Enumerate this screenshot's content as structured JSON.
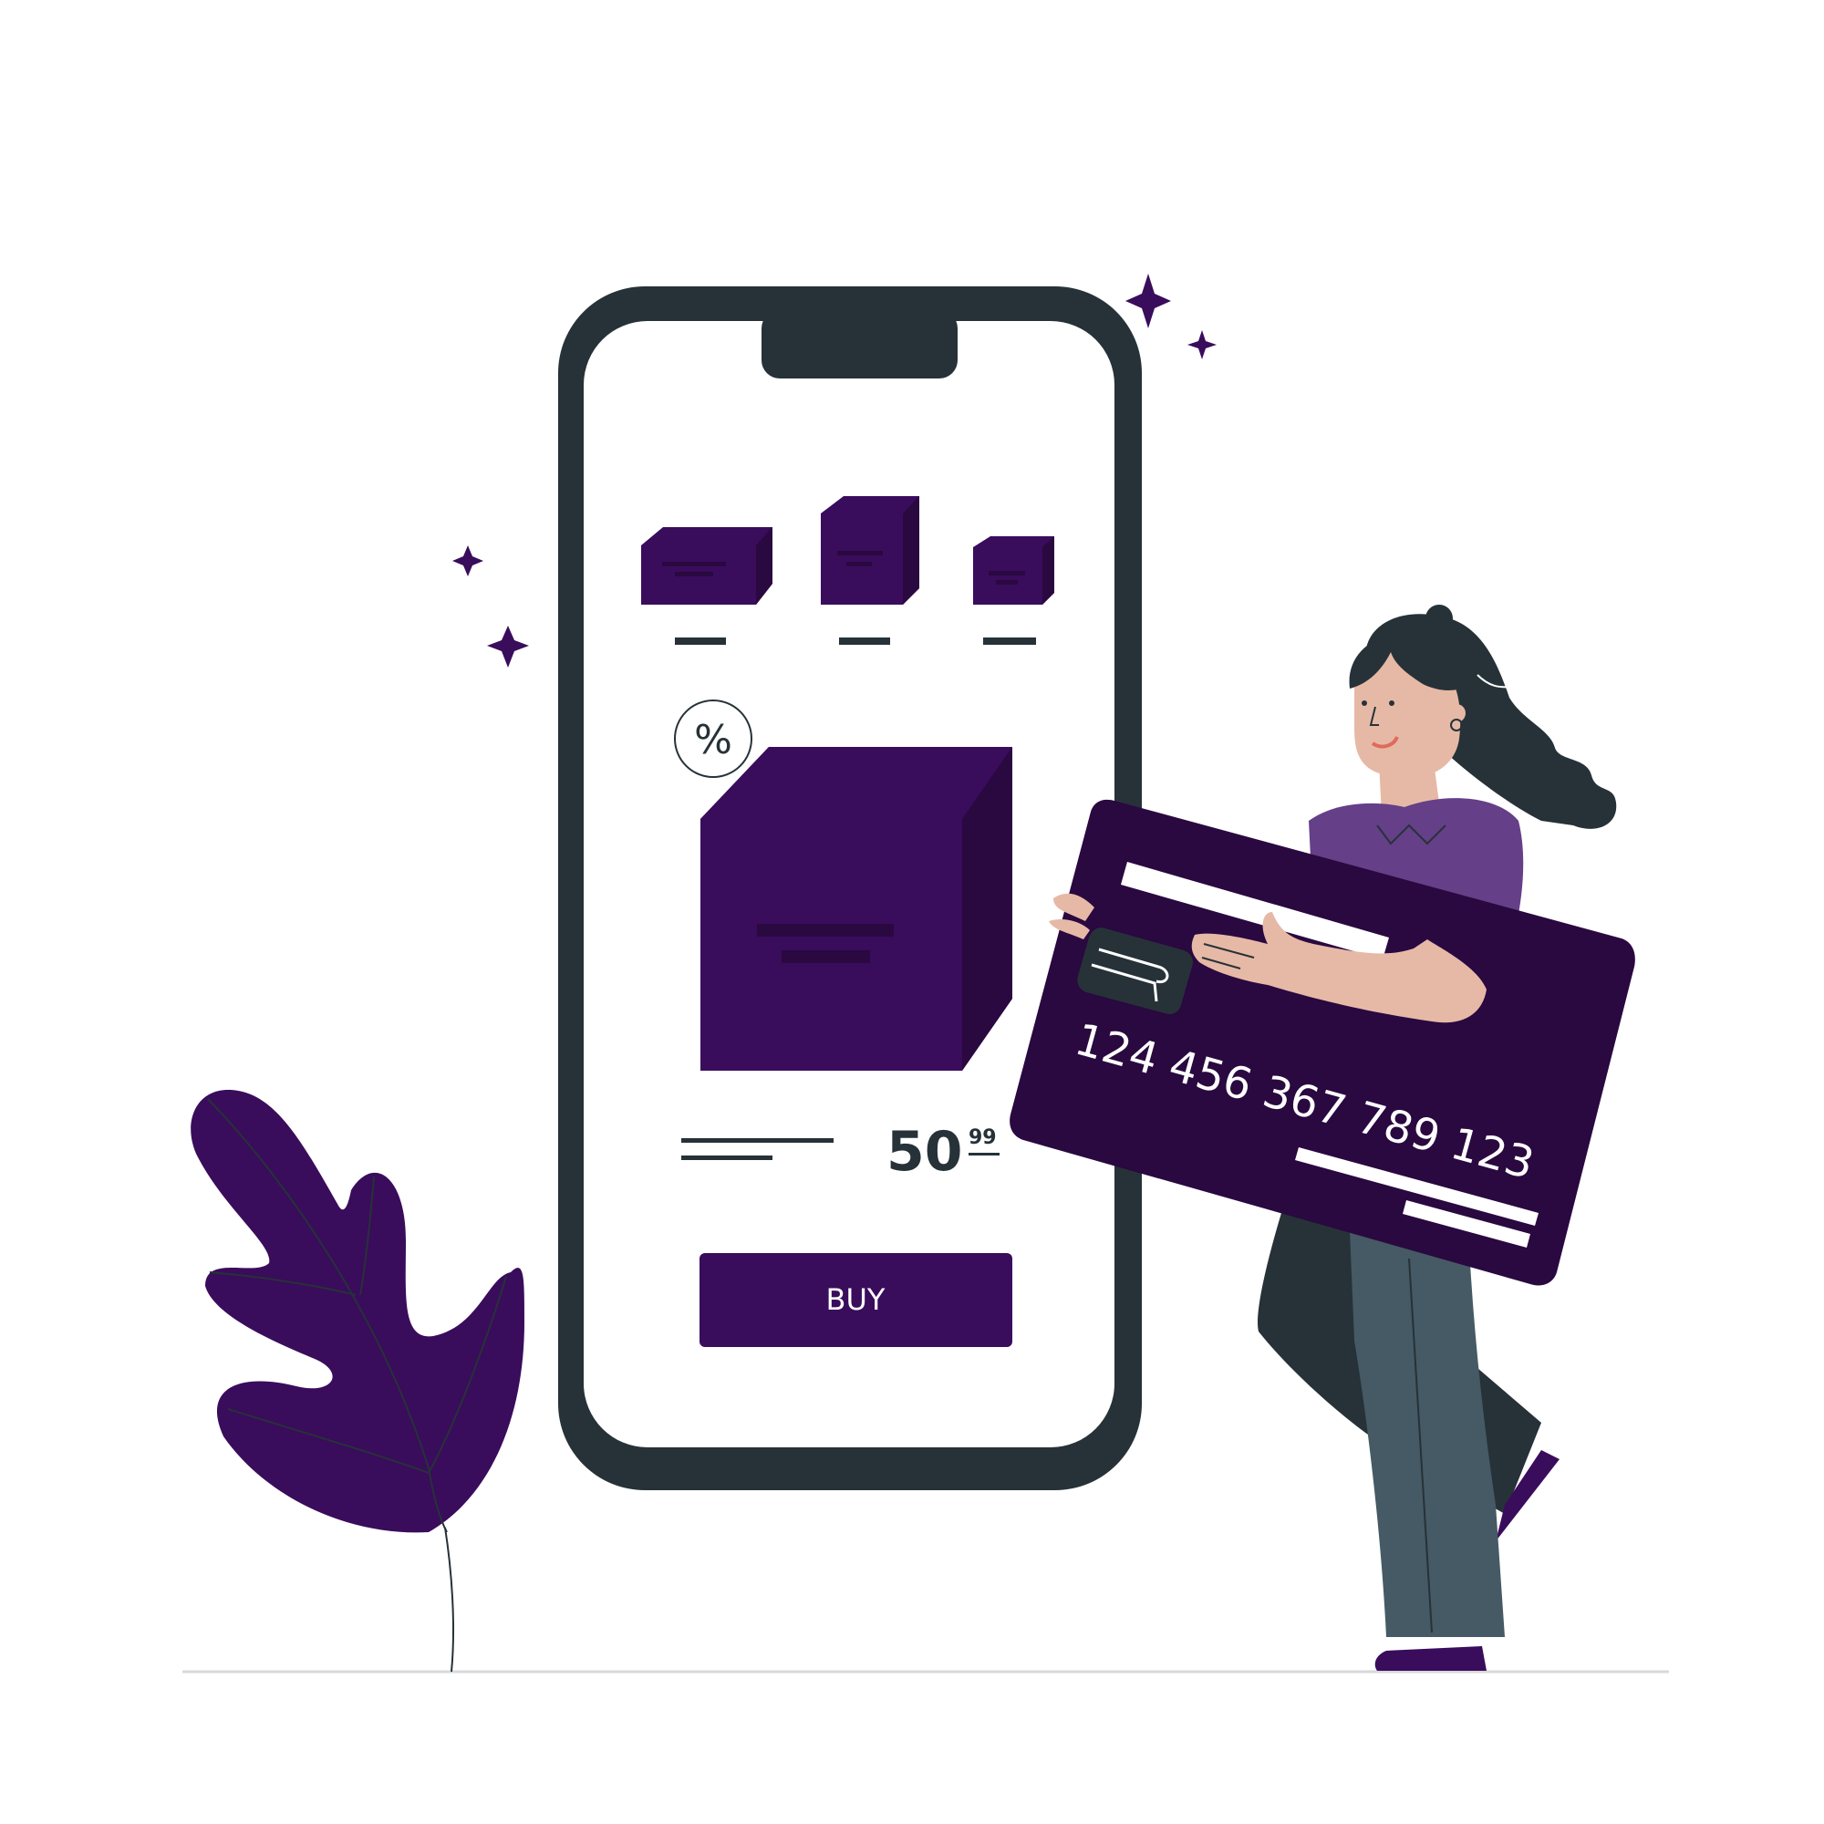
{
  "shop": {
    "discount_symbol": "%",
    "price_main": "50",
    "price_cents": "99",
    "buy_label": "BUY"
  },
  "card": {
    "number": "124 456 367 789 123"
  },
  "colors": {
    "brand_purple": "#3a0c5c",
    "card_purple": "#2a0840",
    "phone_frame": "#263238",
    "skin": "#e6b9a6",
    "shirt": "#653f87",
    "pants": "#455a64"
  },
  "icons": {
    "sparkle": "sparkle-icon",
    "percent_badge": "percent-badge-icon",
    "card_chip": "card-chip-icon"
  }
}
